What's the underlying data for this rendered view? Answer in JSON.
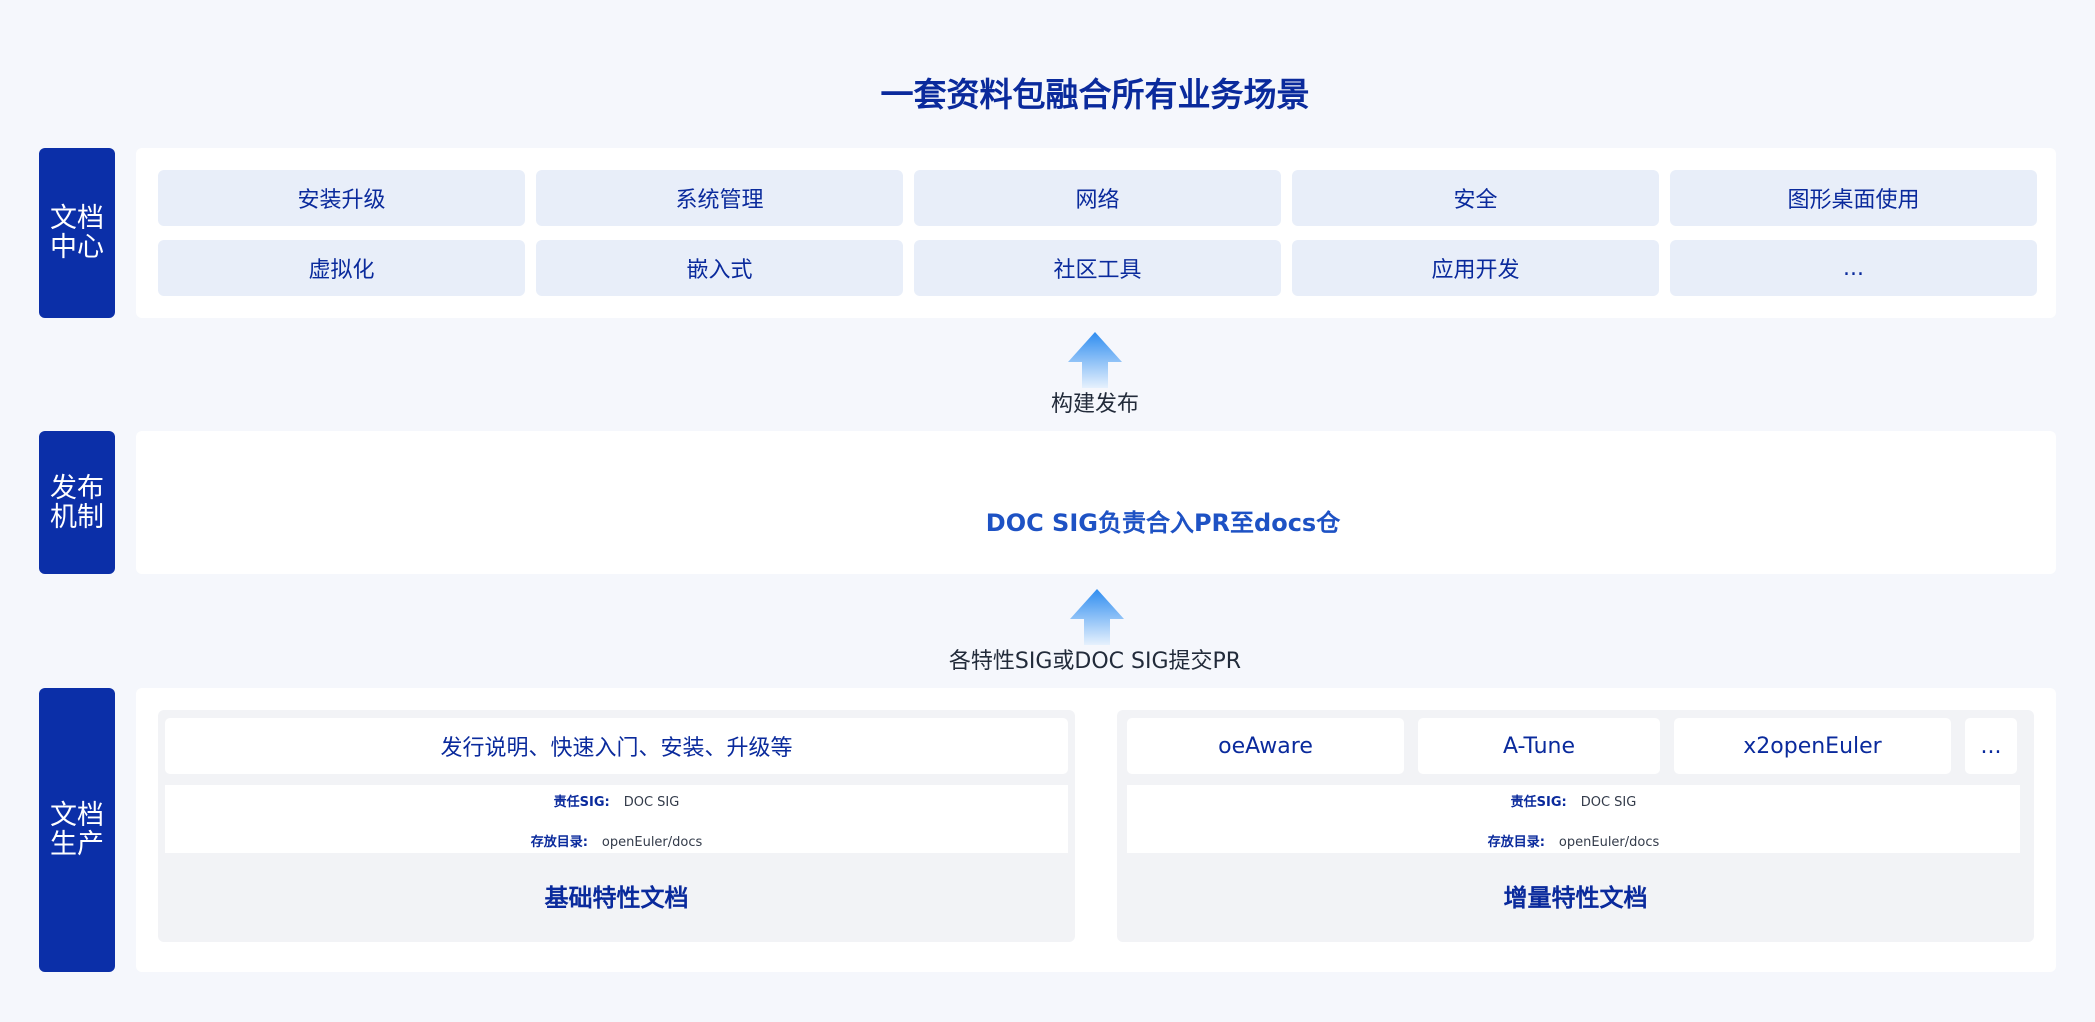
{
  "title": "一套资料包融合所有业务场景",
  "layers": {
    "doc_center": {
      "label_line1": "文档",
      "label_line2": "中心",
      "items": [
        "安装升级",
        "系统管理",
        "网络",
        "安全",
        "图形桌面使用",
        "虚拟化",
        "嵌入式",
        "社区工具",
        "应用开发",
        "..."
      ]
    },
    "build_release_label": "构建发布",
    "release": {
      "label_line1": "发布",
      "label_line2": "机制",
      "text": "DOC SIG负责合入PR至docs仓"
    },
    "submit_label": "各特性SIG或DOC SIG提交PR",
    "production": {
      "label_line1": "文档",
      "label_line2": "生产",
      "basic": {
        "top": "发行说明、快速入门、安装、升级等",
        "owner_key": "责任SIG:",
        "owner_val": "DOC SIG",
        "dir_key": "存放目录:",
        "dir_val": "openEuler/docs",
        "title": "基础特性文档"
      },
      "incremental": {
        "items": [
          "oeAware",
          "A-Tune",
          "x2openEuler",
          "..."
        ],
        "owner_key": "责任SIG:",
        "owner_val": "DOC SIG",
        "dir_key": "存放目录:",
        "dir_val": "openEuler/docs",
        "title": "增量特性文档"
      }
    }
  },
  "colors": {
    "brand_dark": "#0b2fa8",
    "text_blue": "#0a2a9c",
    "cell_bg": "#e8eef9",
    "group_bg": "#f2f3f6",
    "arrow_top": "#2f8df0",
    "arrow_bottom": "#e6f1fd"
  }
}
